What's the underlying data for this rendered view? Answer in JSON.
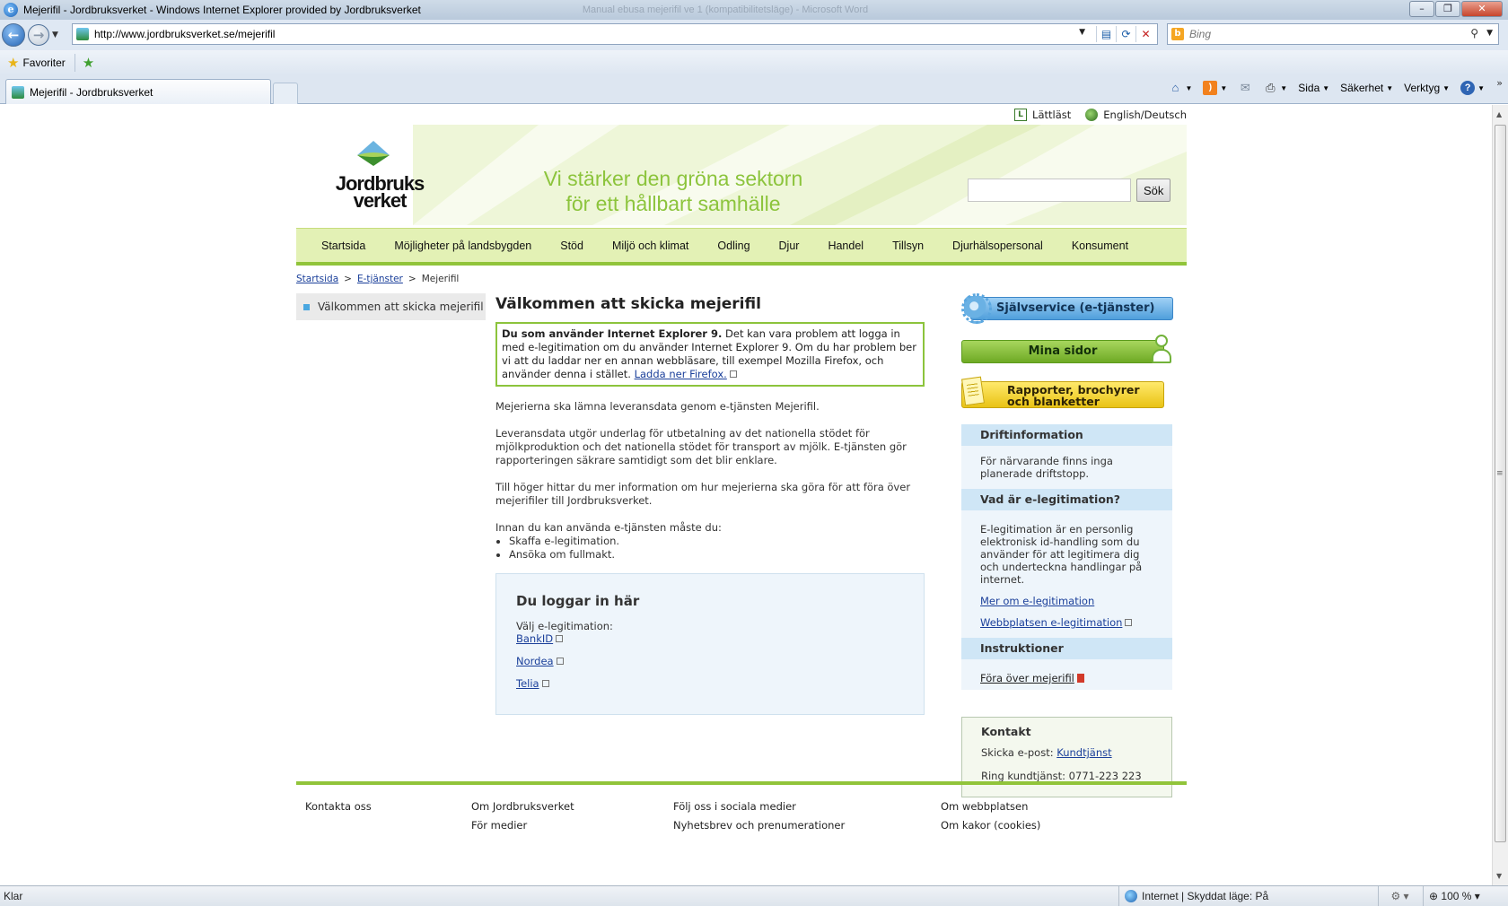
{
  "browser": {
    "window_title": "Mejerifil - Jordbruksverket - Windows Internet Explorer provided by Jordbruksverket",
    "ghost_title": "Manual ebusa mejerifil ve 1 (kompatibilitetsläge) - Microsoft Word",
    "url": "http://www.jordbruksverket.se/mejerifil",
    "search_placeholder": "Bing",
    "favorites_label": "Favoriter",
    "tab_title": "Mejerifil - Jordbruksverket",
    "commands": {
      "page": "Sida",
      "safety": "Säkerhet",
      "tools": "Verktyg"
    },
    "status": {
      "ready": "Klar",
      "zone": "Internet | Skyddat läge: På",
      "zoom": "100 %"
    }
  },
  "site": {
    "top_links": {
      "easy_read": "Lättläst",
      "languages": "English/Deutsch"
    },
    "logo_line1": "Jordbruks",
    "logo_line2": "verket",
    "slogan_line1": "Vi stärker den gröna sektorn",
    "slogan_line2": "för ett hållbart samhälle",
    "search_button": "Sök",
    "nav": [
      "Startsida",
      "Möjligheter på landsbygden",
      "Stöd",
      "Miljö och klimat",
      "Odling",
      "Djur",
      "Handel",
      "Tillsyn",
      "Djurhälsopersonal",
      "Konsument"
    ],
    "breadcrumb": {
      "home": "Startsida",
      "eservices": "E-tjänster",
      "current": "Mejerifil"
    },
    "leftnav_item": "Välkommen att skicka mejerifil"
  },
  "main": {
    "title": "Välkommen att skicka mejerifil",
    "notice_bold": "Du som använder Internet Explorer 9.",
    "notice_text": " Det kan vara problem att logga in med e-legitimation om du använder Internet Explorer 9. Om du har problem ber vi att du laddar ner en annan webbläsare, till exempel Mozilla Firefox, och använder denna i stället. ",
    "notice_link": "Ladda ner Firefox.",
    "para1": "Mejerierna ska lämna leveransdata genom e-tjänsten Mejerifil.",
    "para2": "Leveransdata utgör underlag för utbetalning av det nationella stödet för mjölkproduktion och det nationella stödet för transport av mjölk. E-tjänsten gör rapporteringen säkrare samtidigt som det blir enklare.",
    "para3": "Till höger hittar du mer information om hur mejerierna ska göra för att föra över mejerifiler till Jordbruksverket.",
    "para4": "Innan du kan använda e-tjänsten måste du:",
    "bullets": [
      "Skaffa e-legitimation.",
      "Ansöka om fullmakt."
    ],
    "login": {
      "title": "Du loggar in här",
      "label": "Välj e-legitimation:",
      "providers": [
        "BankID",
        "Nordea",
        "Telia"
      ]
    }
  },
  "right": {
    "self_service": "Självservice (e-tjänster)",
    "my_pages": "Mina sidor",
    "reports_line1": "Rapporter, brochyrer",
    "reports_line2": "och blanketter",
    "drift": {
      "title": "Driftinformation",
      "text": "För närvarande finns inga planerade driftstopp."
    },
    "elegit": {
      "title": "Vad är e-legitimation?",
      "text": "E-legitimation är en personlig elektronisk id-handling som du använder för att legitimera dig och underteckna handlingar på internet.",
      "link1": "Mer om e-legitimation",
      "link2": "Webbplatsen e-legitimation"
    },
    "instr": {
      "title": "Instruktioner",
      "link": "Föra över mejerifil"
    },
    "contact": {
      "title": "Kontakt",
      "email_label": "Skicka e-post: ",
      "email_link": "Kundtjänst",
      "phone": "Ring kundtjänst: 0771-223 223"
    }
  },
  "footer": {
    "col1": [
      "Kontakta oss"
    ],
    "col2": [
      "Om Jordbruksverket",
      "För medier"
    ],
    "col3": [
      "Följ oss i sociala medier",
      "Nyhetsbrev och prenumerationer"
    ],
    "col4": [
      "Om webbplatsen",
      "Om kakor (cookies)"
    ]
  }
}
